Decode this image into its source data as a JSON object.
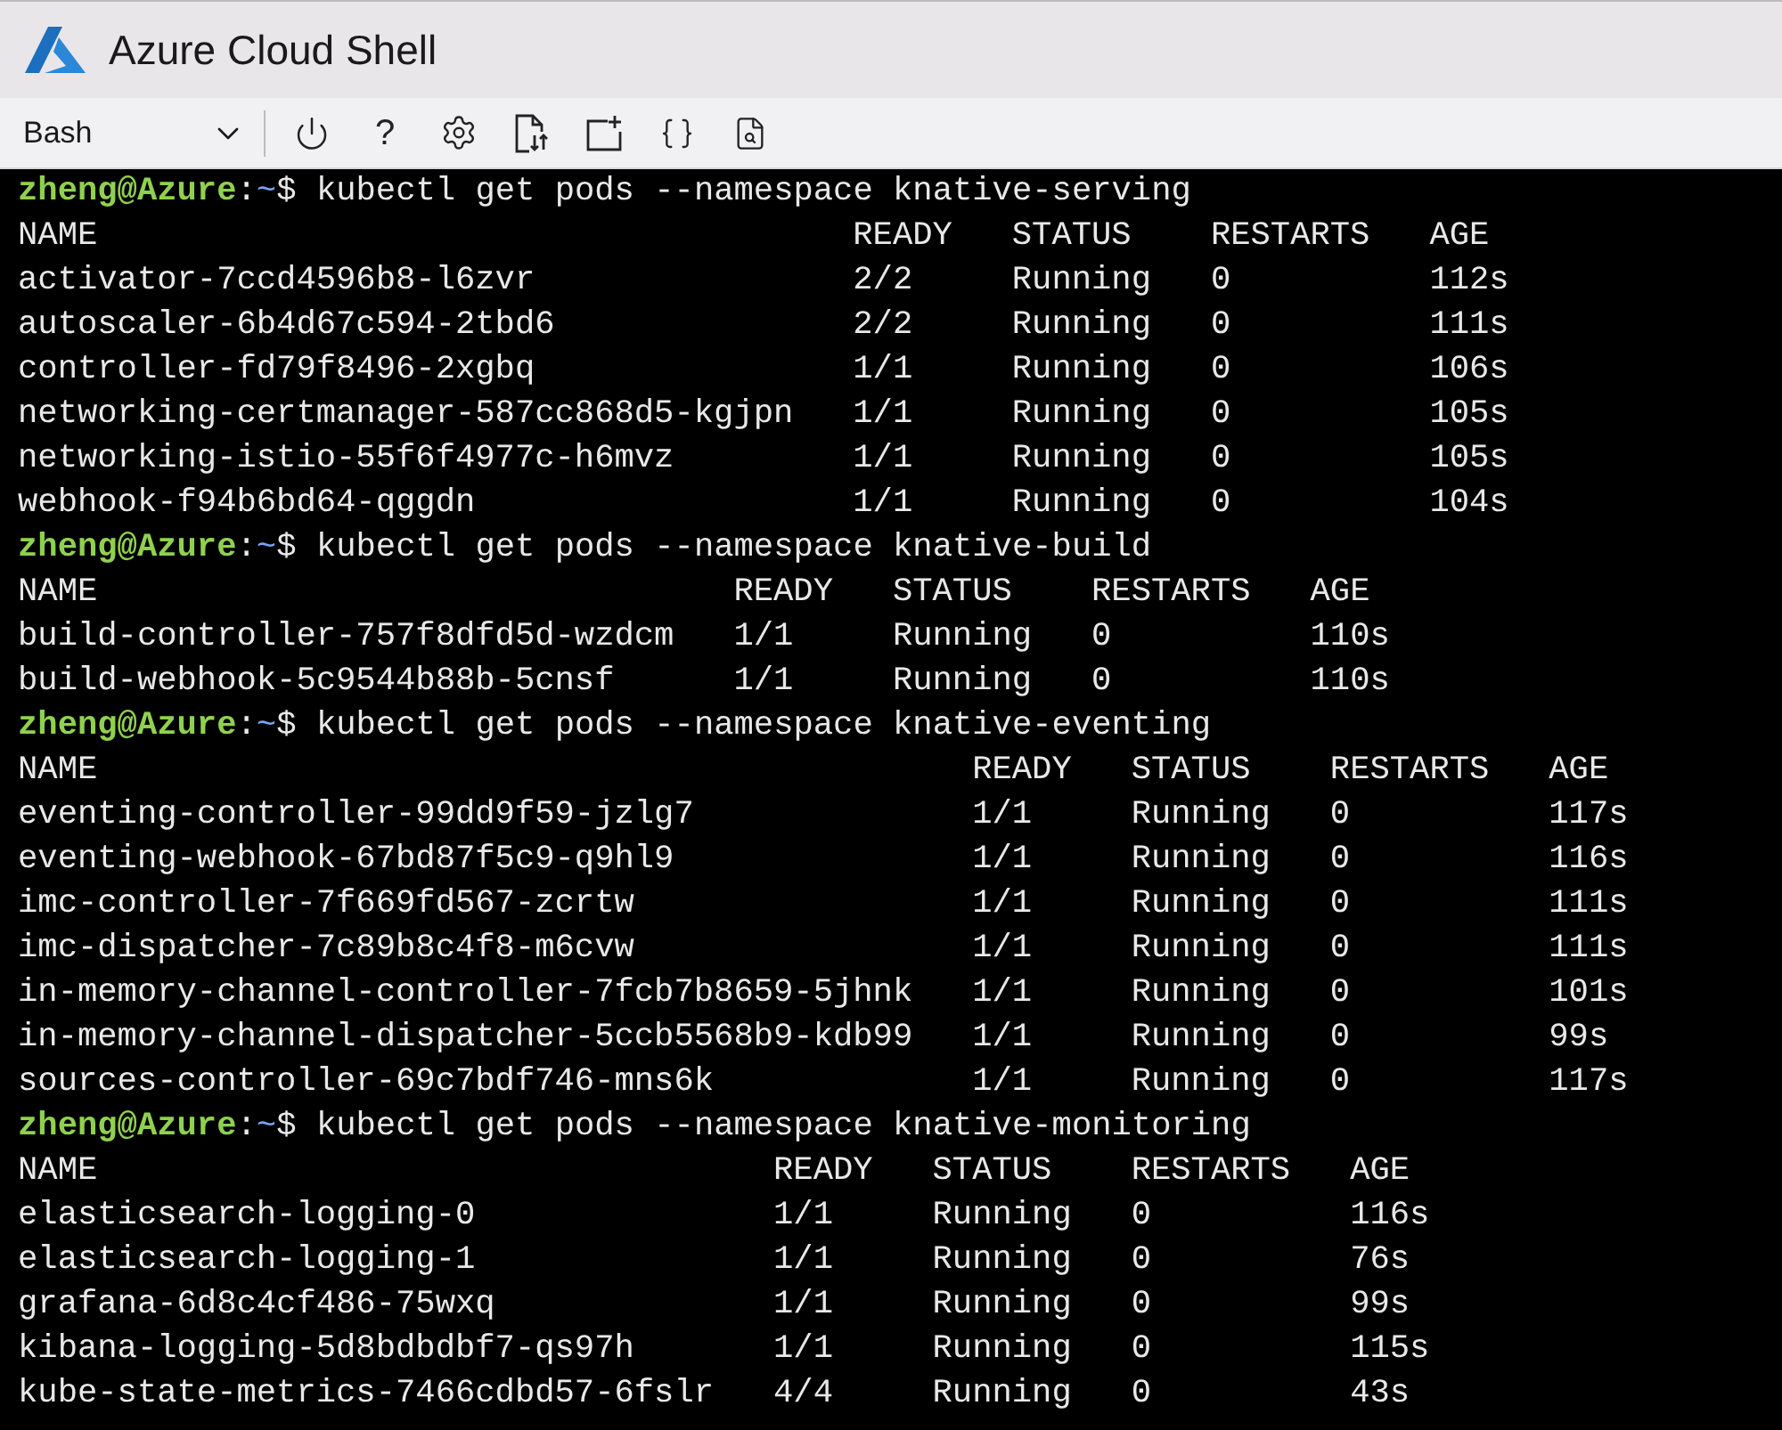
{
  "window": {
    "title": "Azure Cloud Shell"
  },
  "toolbar": {
    "shell": "Bash",
    "help_label": "?"
  },
  "sessions": [
    {
      "prompt": {
        "user": "zheng@Azure",
        "separator": ":",
        "path": "~",
        "symbol": "$"
      },
      "command": "kubectl get pods --namespace knative-serving",
      "columns": [
        "NAME",
        "READY",
        "STATUS",
        "RESTARTS",
        "AGE"
      ],
      "rows": [
        [
          "activator-7ccd4596b8-l6zvr",
          "2/2",
          "Running",
          "0",
          "112s"
        ],
        [
          "autoscaler-6b4d67c594-2tbd6",
          "2/2",
          "Running",
          "0",
          "111s"
        ],
        [
          "controller-fd79f8496-2xgbq",
          "1/1",
          "Running",
          "0",
          "106s"
        ],
        [
          "networking-certmanager-587cc868d5-kgjpn",
          "1/1",
          "Running",
          "0",
          "105s"
        ],
        [
          "networking-istio-55f6f4977c-h6mvz",
          "1/1",
          "Running",
          "0",
          "105s"
        ],
        [
          "webhook-f94b6bd64-qggdn",
          "1/1",
          "Running",
          "0",
          "104s"
        ]
      ]
    },
    {
      "prompt": {
        "user": "zheng@Azure",
        "separator": ":",
        "path": "~",
        "symbol": "$"
      },
      "command": "kubectl get pods --namespace knative-build",
      "columns": [
        "NAME",
        "READY",
        "STATUS",
        "RESTARTS",
        "AGE"
      ],
      "rows": [
        [
          "build-controller-757f8dfd5d-wzdcm",
          "1/1",
          "Running",
          "0",
          "110s"
        ],
        [
          "build-webhook-5c9544b88b-5cnsf",
          "1/1",
          "Running",
          "0",
          "110s"
        ]
      ]
    },
    {
      "prompt": {
        "user": "zheng@Azure",
        "separator": ":",
        "path": "~",
        "symbol": "$"
      },
      "command": "kubectl get pods --namespace knative-eventing",
      "columns": [
        "NAME",
        "READY",
        "STATUS",
        "RESTARTS",
        "AGE"
      ],
      "rows": [
        [
          "eventing-controller-99dd9f59-jzlg7",
          "1/1",
          "Running",
          "0",
          "117s"
        ],
        [
          "eventing-webhook-67bd87f5c9-q9hl9",
          "1/1",
          "Running",
          "0",
          "116s"
        ],
        [
          "imc-controller-7f669fd567-zcrtw",
          "1/1",
          "Running",
          "0",
          "111s"
        ],
        [
          "imc-dispatcher-7c89b8c4f8-m6cvw",
          "1/1",
          "Running",
          "0",
          "111s"
        ],
        [
          "in-memory-channel-controller-7fcb7b8659-5jhnk",
          "1/1",
          "Running",
          "0",
          "101s"
        ],
        [
          "in-memory-channel-dispatcher-5ccb5568b9-kdb99",
          "1/1",
          "Running",
          "0",
          "99s"
        ],
        [
          "sources-controller-69c7bdf746-mns6k",
          "1/1",
          "Running",
          "0",
          "117s"
        ]
      ]
    },
    {
      "prompt": {
        "user": "zheng@Azure",
        "separator": ":",
        "path": "~",
        "symbol": "$"
      },
      "command": "kubectl get pods --namespace knative-monitoring",
      "columns": [
        "NAME",
        "READY",
        "STATUS",
        "RESTARTS",
        "AGE"
      ],
      "rows": [
        [
          "elasticsearch-logging-0",
          "1/1",
          "Running",
          "0",
          "116s"
        ],
        [
          "elasticsearch-logging-1",
          "1/1",
          "Running",
          "0",
          "76s"
        ],
        [
          "grafana-6d8c4cf486-75wxq",
          "1/1",
          "Running",
          "0",
          "99s"
        ],
        [
          "kibana-logging-5d8bdbdbf7-qs97h",
          "1/1",
          "Running",
          "0",
          "115s"
        ],
        [
          "kube-state-metrics-7466cdbd57-6fslr",
          "4/4",
          "Running",
          "0",
          "43s"
        ]
      ]
    }
  ]
}
